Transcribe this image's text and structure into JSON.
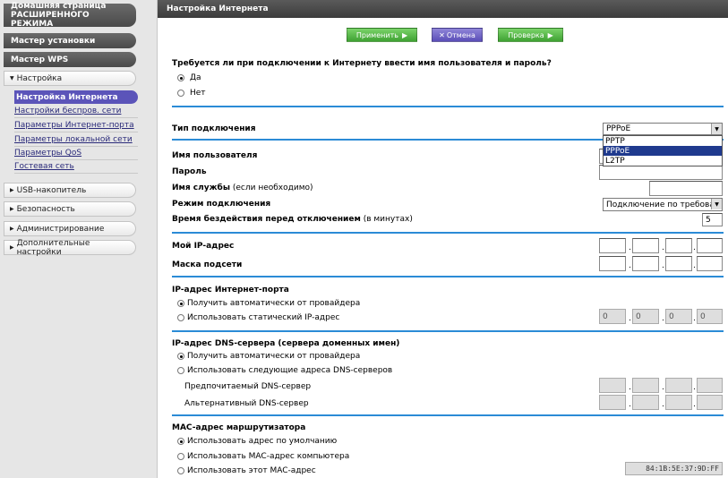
{
  "sidebar": {
    "home": "Домашняя страница РАСШИРЕННОГО РЕЖИМА",
    "setup_wizard": "Мастер установки",
    "wps_wizard": "Мастер WPS",
    "settings": "Настройка",
    "sub_items": [
      "Настройка Интернета",
      "Настройки беспров. сети",
      "Параметры Интернет-порта",
      "Параметры локальной сети",
      "Параметры QoS",
      "Гостевая сеть"
    ],
    "usb": "USB-накопитель",
    "security": "Безопасность",
    "admin": "Администрирование",
    "advanced": "Дополнительные настройки"
  },
  "header": {
    "title": "Настройка Интернета"
  },
  "toolbar": {
    "apply": "Применить",
    "cancel": "Отмена",
    "test": "Проверка"
  },
  "login": {
    "question": "Требуется ли при подключении к Интернету ввести имя пользователя и пароль?",
    "yes": "Да",
    "no": "Нет",
    "selected": "yes"
  },
  "connection": {
    "type_label": "Тип подключения",
    "type_value": "PPPoE",
    "options": [
      "PPTP",
      "PPPoE",
      "L2TP"
    ],
    "selected_option": "PPPoE",
    "username_label": "Имя пользователя",
    "password_label": "Пароль",
    "service_label": "Имя службы",
    "service_hint": "(если необходимо)",
    "mode_label": "Режим подключения",
    "mode_value": "Подключение по требова",
    "idle_label": "Время бездействия перед отключением",
    "idle_hint": "(в минутах)",
    "idle_value": "5"
  },
  "ip": {
    "my_ip_label": "Мой IP-адрес",
    "mask_label": "Маска подсети"
  },
  "wan_ip": {
    "title": "IP-адрес Интернет-порта",
    "auto": "Получить автоматически от провайдера",
    "static": "Использовать статический IP-адрес",
    "octets": [
      "0",
      "0",
      "0",
      "0"
    ]
  },
  "dns": {
    "title": "IP-адрес DNS-сервера (сервера доменных имен)",
    "auto": "Получить автоматически от провайдера",
    "manual": "Использовать следующие адреса DNS-серверов",
    "primary": "Предпочитаемый DNS-сервер",
    "secondary": "Альтернативный DNS-сервер"
  },
  "mac": {
    "title": "MAC-адрес маршрутизатора",
    "default": "Использовать адрес по умолчанию",
    "computer": "Использовать MAC-адрес компьютера",
    "custom": "Использовать этот MAC-адрес",
    "value": "84:1B:5E:37:9D:FF"
  },
  "colors": {
    "accent_line": "#2b8bd6",
    "button_green": "#4fb33f",
    "button_purple": "#6a5ec4",
    "sidebar_active": "#5b54b9"
  }
}
